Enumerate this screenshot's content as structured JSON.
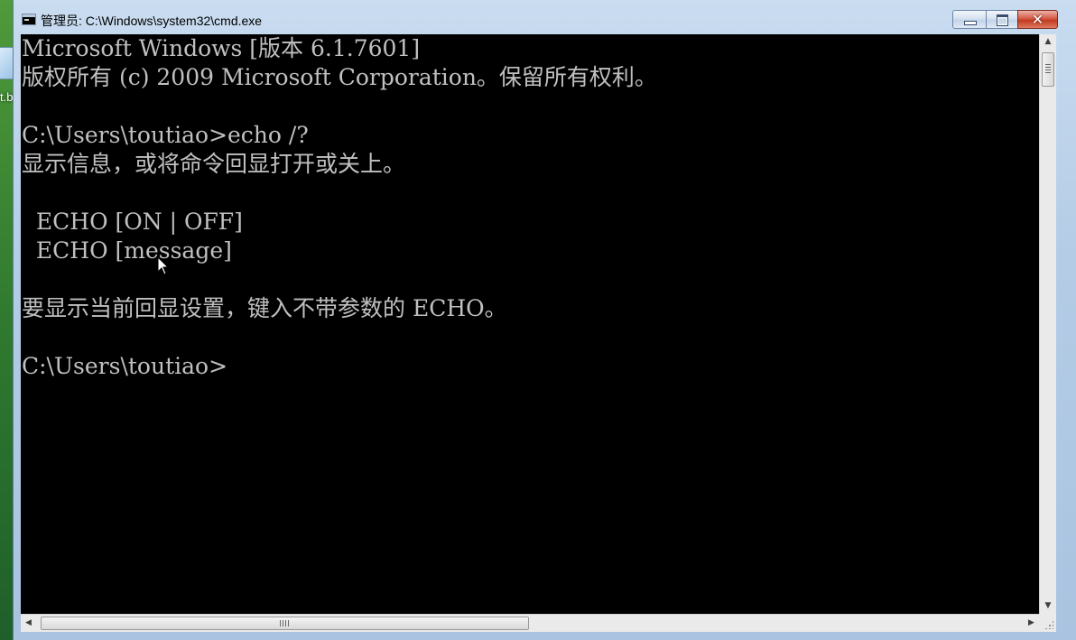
{
  "window": {
    "title": "管理员: C:\\Windows\\system32\\cmd.exe"
  },
  "desktop": {
    "icon_label": "t.b"
  },
  "console": {
    "lines": [
      "Microsoft Windows [版本 6.1.7601]",
      "版权所有 (c) 2009 Microsoft Corporation。保留所有权利。",
      "",
      "C:\\Users\\toutiao>echo /?",
      "显示信息，或将命令回显打开或关上。",
      "",
      "  ECHO [ON | OFF]",
      "  ECHO [message]",
      "",
      "要显示当前回显设置，键入不带参数的 ECHO。",
      "",
      "C:\\Users\\toutiao>"
    ]
  },
  "icons": {
    "app": "cmd-console-icon",
    "minimize": "minimize-icon",
    "maximize": "maximize-icon",
    "close": "close-icon",
    "cursor": "mouse-pointer-icon"
  },
  "colors": {
    "console_bg": "#000000",
    "console_fg": "#c0c0c0",
    "close_button": "#c23a22",
    "titlebar": "#c9dcf0"
  }
}
